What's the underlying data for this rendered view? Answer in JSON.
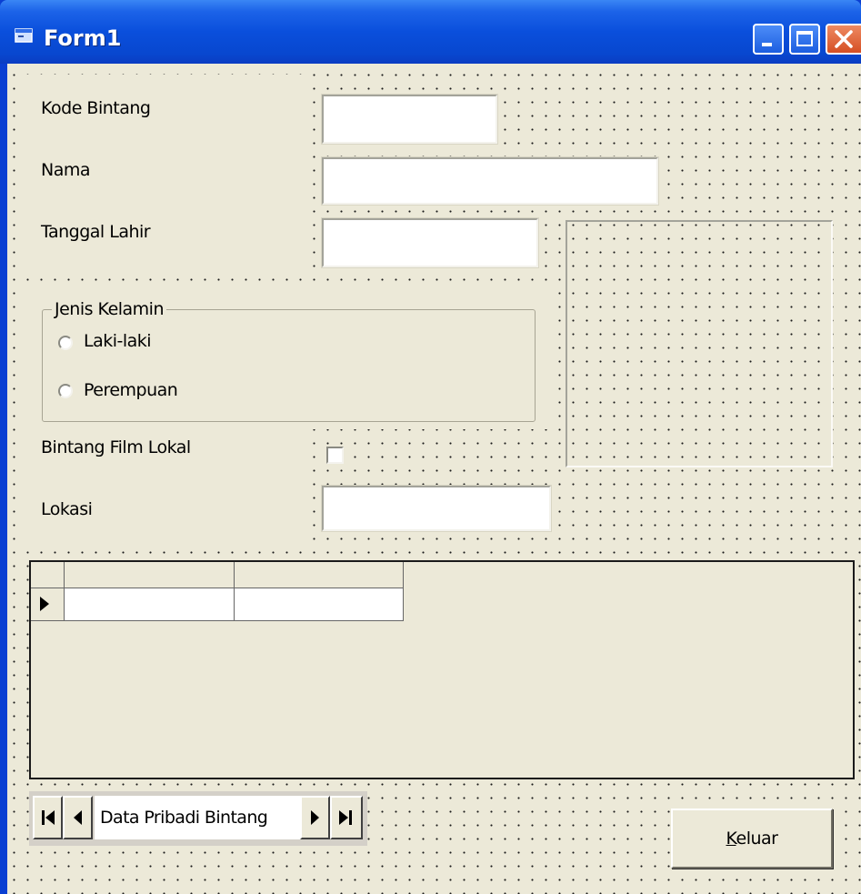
{
  "window": {
    "title": "Form1",
    "icon": "vb-form-icon",
    "controls": [
      "minimize-icon",
      "maximize-icon",
      "close-icon"
    ]
  },
  "form": {
    "kode_label": "Kode Bintang",
    "kode_value": "",
    "nama_label": "Nama",
    "nama_value": "",
    "tanggal_label": "Tanggal Lahir",
    "tanggal_value": "",
    "gender_frame": {
      "caption": "Jenis Kelamin",
      "options": [
        "Laki-laki",
        "Perempuan"
      ],
      "selected": null
    },
    "bintang_lokal_label": "Bintang Film Lokal",
    "bintang_lokal_checked": false,
    "lokasi_label": "Lokasi",
    "lokasi_value": ""
  },
  "grid": {
    "columns": [
      "",
      ""
    ],
    "rows": [
      [
        "",
        ""
      ]
    ],
    "current_row_marker": "row-pointer-icon"
  },
  "data_control": {
    "caption": "Data Pribadi Bintang",
    "buttons": [
      "first-record-icon",
      "previous-record-icon",
      "next-record-icon",
      "last-record-icon"
    ]
  },
  "buttons": {
    "keluar_accel": "K",
    "keluar_rest": "eluar"
  },
  "colors": {
    "titlebar": "#0a4fdc",
    "form_background": "#ece9d8",
    "close_button": "#d54f24"
  }
}
